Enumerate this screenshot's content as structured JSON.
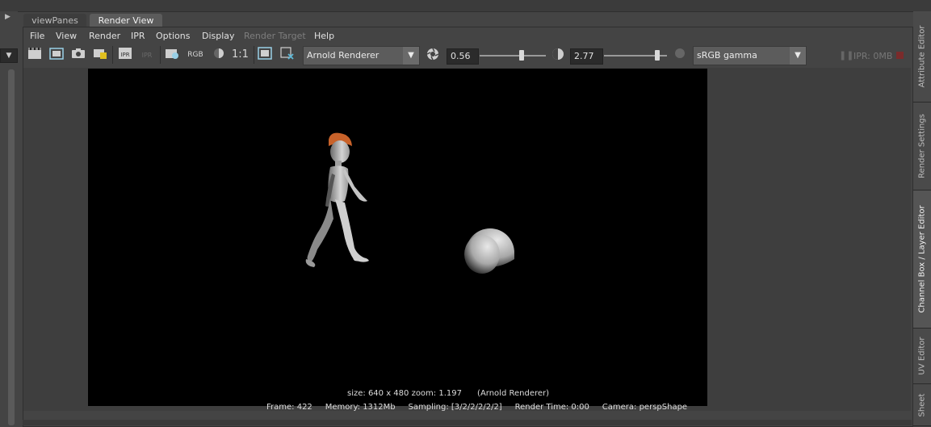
{
  "tabs": {
    "view_panes": "viewPanes",
    "render_view": "Render View"
  },
  "menu": {
    "file": "File",
    "view": "View",
    "render": "Render",
    "ipr": "IPR",
    "options": "Options",
    "display": "Display",
    "render_target": "Render Target",
    "help": "Help"
  },
  "toolbar": {
    "rgb": "RGB",
    "one_to_one": "1:1",
    "renderer": "Arnold Renderer",
    "exposure": "0.56",
    "gamma_value": "2.77",
    "color_space": "sRGB gamma",
    "ipr_memory": "IPR: 0MB"
  },
  "image_info": "size: 640 x 480 zoom: 1.197      (Arnold Renderer)",
  "status": {
    "frame": "Frame: 422",
    "memory": "Memory: 1312Mb",
    "sampling": "Sampling: [3/2/2/2/2/2]",
    "render_time": "Render Time: 0:00",
    "camera": "Camera: perspShape"
  },
  "right_tabs": {
    "attribute_editor": "Attribute Editor",
    "render_settings": "Render Settings",
    "channel_box": "Channel Box / Layer Editor",
    "uv_editor": "UV Editor",
    "sheet": "Sheet"
  },
  "colors": {
    "background": "#444444",
    "render_bg": "#000000",
    "hair": "#c8622a",
    "skin": "#d0d0d0"
  }
}
